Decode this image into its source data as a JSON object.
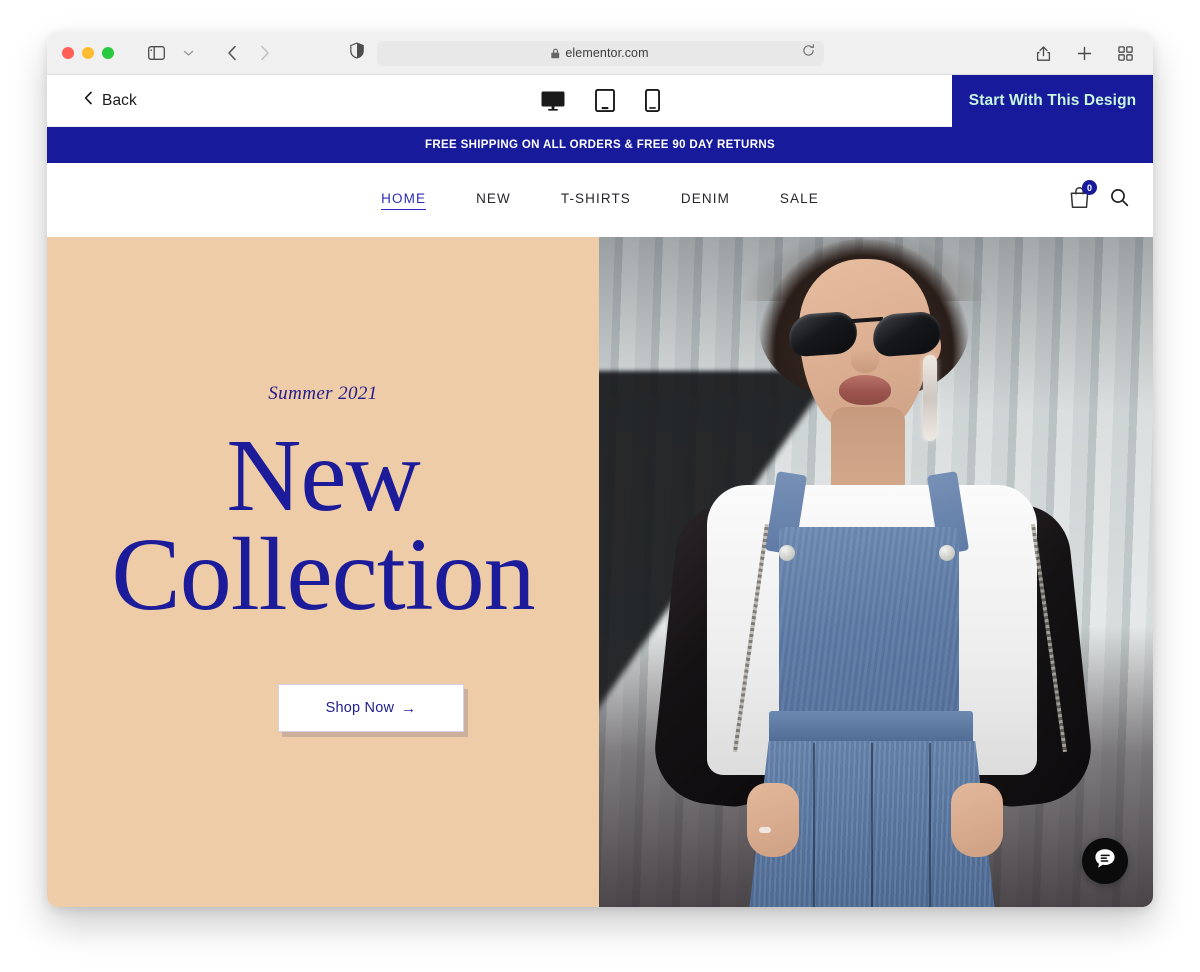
{
  "browser": {
    "traffic_lights": [
      "close",
      "minimize",
      "zoom"
    ],
    "url": "elementor.com",
    "lock_icon": "lock-icon",
    "shield_icon": "privacy-shield-icon",
    "reload_icon": "reload-icon",
    "sidebar_icon": "sidebar-toggle-icon",
    "chevron_icon": "chevron-down-icon",
    "back_icon": "nav-back-icon",
    "forward_icon": "nav-forward-icon",
    "share_icon": "share-icon",
    "newtab_icon": "plus-icon",
    "tabs_icon": "tab-overview-icon"
  },
  "preview_bar": {
    "back_label": "Back",
    "back_chevron": "chevron-left-icon",
    "devices": [
      {
        "name": "desktop",
        "active": true
      },
      {
        "name": "tablet",
        "active": false
      },
      {
        "name": "mobile",
        "active": false
      }
    ],
    "cta_label": "Start With This Design",
    "cta_bg": "#171a9b",
    "cta_color": "#c8f5df"
  },
  "site": {
    "announcement": {
      "text": "FREE SHIPPING ON ALL ORDERS & FREE 90 DAY RETURNS",
      "bg": "#171a9b",
      "color": "#ffffff"
    },
    "nav": {
      "items": [
        {
          "label": "HOME",
          "active": true
        },
        {
          "label": "NEW",
          "active": false
        },
        {
          "label": "T-SHIRTS",
          "active": false
        },
        {
          "label": "DENIM",
          "active": false
        },
        {
          "label": "SALE",
          "active": false
        }
      ],
      "cart": {
        "icon": "shopping-bag-icon",
        "count": "0",
        "badge_bg": "#171a9b"
      },
      "search": {
        "icon": "search-icon"
      }
    },
    "hero": {
      "bg": "#efcca8",
      "eyebrow": "Summer 2021",
      "title_line1": "New",
      "title_line2": "Collection",
      "title_color": "#1c1c9a",
      "cta_label": "Shop Now",
      "cta_arrow": "→",
      "image_alt": "Woman wearing sunglasses, white t-shirt, denim overall dress and black satin bomber jacket standing in front of a corrugated metal staircase"
    },
    "chat": {
      "icon": "chat-bubble-icon",
      "bg": "#0b0b0b"
    }
  }
}
